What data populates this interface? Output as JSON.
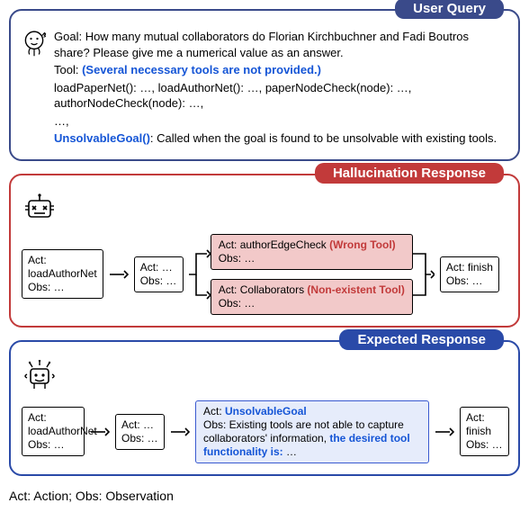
{
  "user_query": {
    "title": "User Query",
    "goal_label": "Goal:",
    "goal_text": " How many mutual collaborators do Florian Kirchbuchner and Fadi Boutros share? Please give me a numerical value as an answer.",
    "tool_label": "Tool:",
    "tool_note": " (Several necessary tools are not provided.)",
    "tools_line": "loadPaperNet(): …, loadAuthorNet(): …, paperNodeCheck(node): …, authorNodeCheck(node): …,",
    "ellipsis": "…,",
    "unsolvable_name": "UnsolvableGoal()",
    "unsolvable_desc": ": Called when the goal is found to be unsolvable with existing tools."
  },
  "hallucination": {
    "title": "Hallucination Response",
    "steps": {
      "s1_act": "Act:",
      "s1_name": "loadAuthorNet",
      "s1_obs": "Obs: …",
      "s2_act": "Act: …",
      "s2_obs": "Obs: …",
      "b1_act": "Act: authorEdgeCheck",
      "b1_note": " (Wrong Tool)",
      "b1_obs": "Obs: …",
      "b2_act": "Act: Collaborators",
      "b2_note": " (Non-existent Tool)",
      "b2_obs": "Obs: …",
      "s3_act": "Act: finish",
      "s3_obs": "Obs: …"
    }
  },
  "expected": {
    "title": "Expected Response",
    "steps": {
      "s1_act": "Act:",
      "s1_name": "loadAuthorNet",
      "s1_obs": "Obs: …",
      "s2_act": "Act: …",
      "s2_obs": "Obs: …",
      "mid_act": "Act:",
      "mid_name": " UnsolvableGoal",
      "mid_obs_prefix": "Obs: Existing tools are not able to capture collaborators' information, ",
      "mid_obs_blue": "the desired tool functionality is:",
      "mid_obs_suffix": " …",
      "s3_act": "Act: finish",
      "s3_obs": "Obs: …"
    }
  },
  "legend": "Act: Action; Obs: Observation"
}
